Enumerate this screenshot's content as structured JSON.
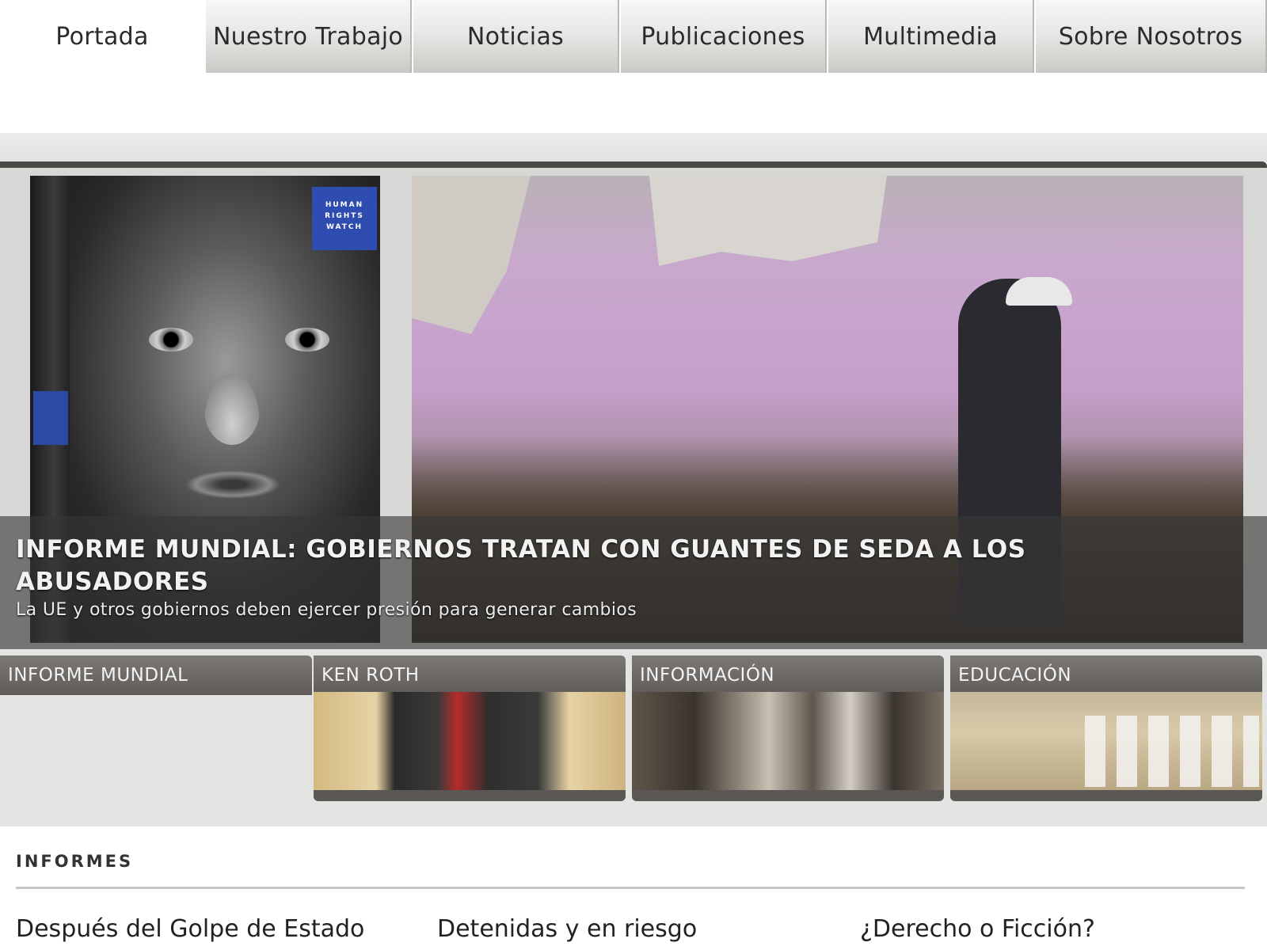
{
  "nav": {
    "tabs": [
      {
        "label": "Portada"
      },
      {
        "label": "Nuestro Trabajo"
      },
      {
        "label": "Noticias"
      },
      {
        "label": "Publicaciones"
      },
      {
        "label": "Multimedia"
      },
      {
        "label": "Sobre Nosotros"
      }
    ],
    "active_index": 0
  },
  "hero": {
    "cover_logo": "HUMAN RIGHTS WATCH",
    "title": "INFORME MUNDIAL: GOBIERNOS TRATAN CON GUANTES DE SEDA A LOS ABUSADORES",
    "subtitle": "La UE y otros gobiernos deben ejercer presión para generar cambios"
  },
  "features": [
    {
      "label": "INFORME MUNDIAL"
    },
    {
      "label": "KEN ROTH"
    },
    {
      "label": "INFORMACIÓN"
    },
    {
      "label": "EDUCACIÓN"
    }
  ],
  "reports": {
    "title": "INFORMES",
    "items": [
      {
        "label": "Después del Golpe de Estado"
      },
      {
        "label": "Detenidas y en riesgo"
      },
      {
        "label": "¿Derecho o Ficción?"
      }
    ]
  },
  "colors": {
    "nav_gradient_top": "#f7f7f6",
    "nav_gradient_bottom": "#c9c9c6",
    "feature_label_bg": "#6b6866",
    "hero_caption_bg": "#373737",
    "cover_logo_blue": "#2f4cb0"
  }
}
